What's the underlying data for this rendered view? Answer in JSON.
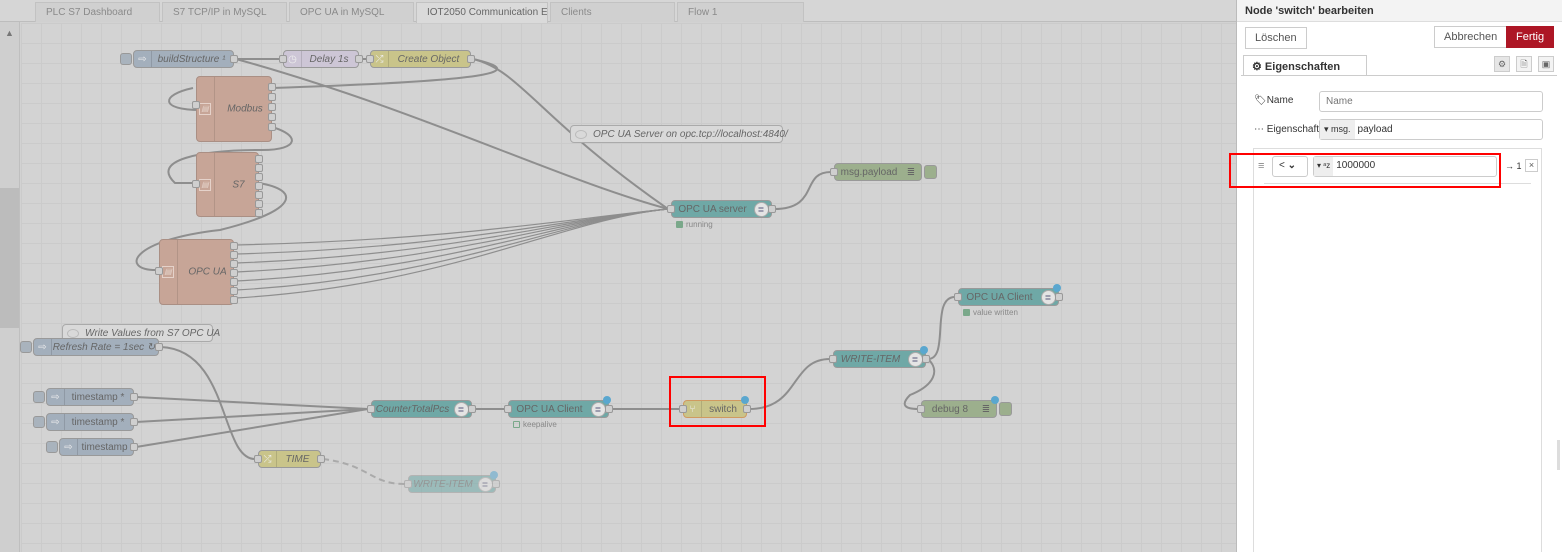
{
  "tabs": [
    "PLC S7 Dashboard",
    "S7 TCP/IP in MySQL",
    "OPC UA in MySQL",
    "IOT2050 Communication E:",
    "Clients",
    "Flow 1"
  ],
  "active_tab": 3,
  "canvas": {
    "nodes": {
      "buildStructure": "buildStructure ¹",
      "delay": "Delay 1s",
      "create_object": "Create Object",
      "modbus": "Modbus",
      "s7": "S7",
      "opcua": "OPC UA",
      "opcua_server": "OPC UA server",
      "msg_payload": "msg.payload",
      "refresh": "Refresh Rate = 1sec ↻",
      "ts1": "timestamp *",
      "ts2": "timestamp *",
      "ts3": "timestamp",
      "counter": "CounterTotalPcs",
      "client1": "OPC UA Client",
      "switch": "switch",
      "write_item": "WRITE-ITEM",
      "client2": "OPC UA Client",
      "debug8": "debug 8",
      "time": "TIME",
      "write_item2": "WRITE-ITEM"
    },
    "comments": {
      "server": "OPC UA Server on opc.tcp://localhost:4840/",
      "write": "Write Values from S7 OPC UA"
    },
    "status": {
      "server": "running",
      "client1": "keepalive",
      "client2": "value written"
    }
  },
  "panel": {
    "title": "Node 'switch' bearbeiten",
    "delete": "Löschen",
    "cancel": "Abbrechen",
    "done": "Fertig",
    "tab": "Eigenschaften",
    "name_label": "Name",
    "name_placeholder": "Name",
    "property_label": "Eigenschaft",
    "property_prefix": "msg.",
    "property_value": "payload",
    "rule": {
      "operator": "<",
      "type_icon": "ᵃz",
      "value": "1000000",
      "output": "→ 1",
      "remove": "×"
    }
  },
  "colors": {
    "accent": "#ad1625",
    "highlight": "#ff0000"
  }
}
